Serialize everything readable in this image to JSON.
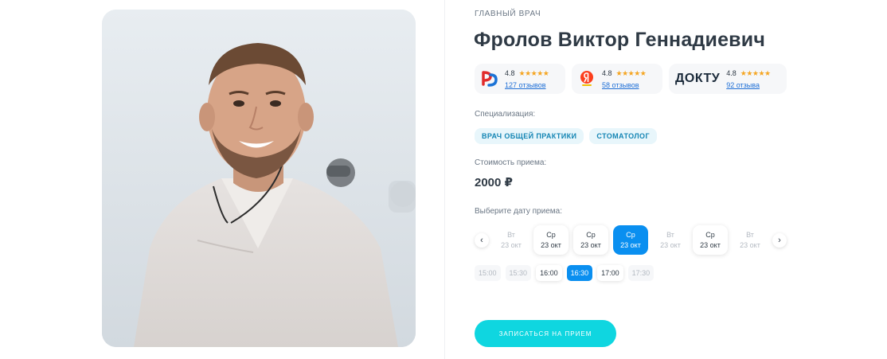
{
  "doctor": {
    "role": "ГЛАВНЫЙ ВРАЧ",
    "name": "Фролов Виктор Геннадиевич",
    "photo_alt": "doctor-photo"
  },
  "reviews": [
    {
      "source_icon": "prodoctorov-logo",
      "rating": "4.8",
      "stars": "★★★★★",
      "link": "127 отзывов"
    },
    {
      "source_icon": "yandex-logo",
      "rating": "4.8",
      "stars": "★★★★★",
      "link": "58 отзывов"
    },
    {
      "source_icon": "dokty-logo",
      "brand": "ДОКТУ",
      "rating": "4.8",
      "stars": "★★★★★",
      "link": "92 отзыва"
    }
  ],
  "specialization": {
    "label": "Специализация:",
    "tags": [
      "ВРАЧ ОБЩЕЙ ПРАКТИКИ",
      "СТОМАТОЛОГ"
    ]
  },
  "price": {
    "label": "Стоимость приема:",
    "value": "2000 ₽"
  },
  "date_picker": {
    "label": "Выберите дату приема:",
    "prev": "‹",
    "next": "›",
    "days": [
      {
        "weekday": "Вт",
        "date": "23 окт",
        "state": "disabled"
      },
      {
        "weekday": "Ср",
        "date": "23 окт",
        "state": "enabled"
      },
      {
        "weekday": "Ср",
        "date": "23 окт",
        "state": "enabled"
      },
      {
        "weekday": "Ср",
        "date": "23 окт",
        "state": "selected"
      },
      {
        "weekday": "Вт",
        "date": "23 окт",
        "state": "disabled"
      },
      {
        "weekday": "Ср",
        "date": "23 окт",
        "state": "enabled"
      },
      {
        "weekday": "Вт",
        "date": "23 окт",
        "state": "disabled"
      }
    ]
  },
  "times": [
    {
      "value": "15:00",
      "state": "disabled"
    },
    {
      "value": "15:30",
      "state": "disabled"
    },
    {
      "value": "16:00",
      "state": "enabled"
    },
    {
      "value": "16:30",
      "state": "selected"
    },
    {
      "value": "17:00",
      "state": "enabled"
    },
    {
      "value": "17:30",
      "state": "disabled"
    }
  ],
  "cta": {
    "label": "ЗАПИСАТЬСЯ НА ПРИЕМ"
  },
  "colors": {
    "accent": "#0a8ff0",
    "cta": "#0fd6e0",
    "star": "#f5a623",
    "tag_bg": "#e8f6fb",
    "tag_text": "#1485b4"
  }
}
